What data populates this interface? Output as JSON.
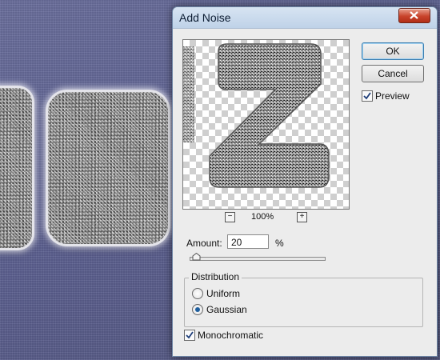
{
  "dialog": {
    "title": "Add Noise",
    "ok_label": "OK",
    "cancel_label": "Cancel",
    "preview_label": "Preview",
    "preview_checked": true,
    "zoom": {
      "minus_icon": "zoom-out-icon",
      "plus_icon": "zoom-in-icon",
      "minus_glyph": "−",
      "plus_glyph": "+",
      "value": "100%"
    },
    "amount": {
      "label": "Amount:",
      "value": "20",
      "unit": "%",
      "slider_fraction": 0.05
    },
    "distribution": {
      "title": "Distribution",
      "options": [
        "Uniform",
        "Gaussian"
      ],
      "selected": "Gaussian"
    },
    "monochromatic": {
      "label": "Monochromatic",
      "checked": true
    }
  },
  "colors": {
    "canvas_bg": "#5b5f8e",
    "dialog_bg": "#ececec",
    "title_bar": "#c8d9ec",
    "close_button": "#c8432b",
    "default_button_border": "#3c7fb1"
  }
}
